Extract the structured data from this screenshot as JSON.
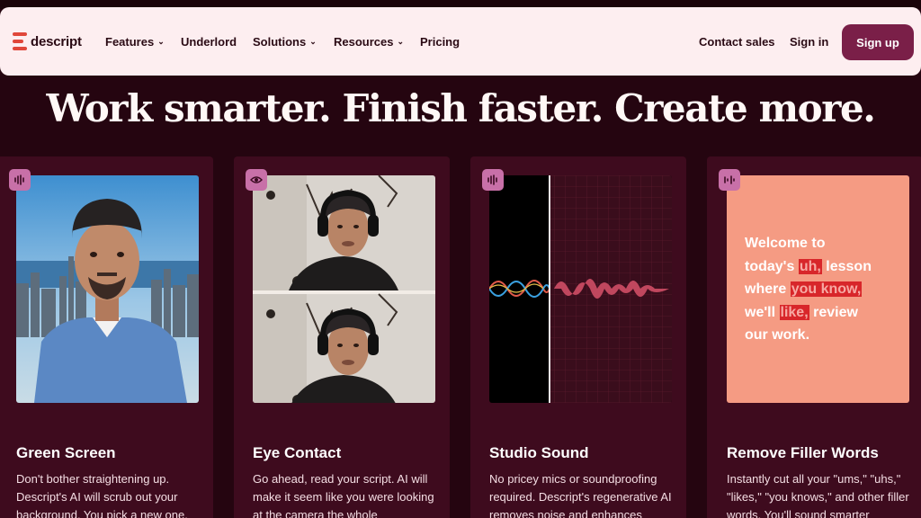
{
  "header": {
    "logo_text": "descript",
    "nav": [
      {
        "label": "Features",
        "dropdown": true
      },
      {
        "label": "Underlord",
        "dropdown": false
      },
      {
        "label": "Solutions",
        "dropdown": true
      },
      {
        "label": "Resources",
        "dropdown": true
      },
      {
        "label": "Pricing",
        "dropdown": false
      }
    ],
    "contact_sales": "Contact sales",
    "sign_in": "Sign in",
    "sign_up": "Sign up"
  },
  "hero": {
    "headline": "Work smarter. Finish faster. Create more."
  },
  "cards": [
    {
      "title": "Green Screen",
      "desc": "Don't bother straightening up. Descript's AI will scrub out your background. You pick a new one.",
      "badge_icon": "waveform-icon"
    },
    {
      "title": "Eye Contact",
      "desc": "Go ahead, read your script. AI will make it seem like you were looking at the camera the whole",
      "badge_icon": "eye-icon"
    },
    {
      "title": "Studio Sound",
      "desc": "No pricey mics or soundproofing required. Descript's regenerative AI removes noise and enhances",
      "badge_icon": "waveform-icon"
    },
    {
      "title": "Remove Filler Words",
      "desc": "Instantly cut all your \"ums,\" \"uhs,\" \"likes,\" \"you knows,\" and other filler words. You'll sound smarter",
      "badge_icon": "filler-words-icon"
    }
  ],
  "filler_demo": {
    "w1": "Welcome to",
    "w2": "today's",
    "f1": "uh,",
    "w3": "lesson",
    "w4": "where",
    "f2": "you know,",
    "w5": "we'll",
    "f3": "like,",
    "w6": "review",
    "w7": "our work."
  },
  "colors": {
    "background": "#250510",
    "nav_background": "#fdeef0",
    "card_background": "#3e0b1e",
    "accent": "#7a1f48",
    "badge": "#c870a8",
    "filler_card": "#f59b83",
    "filler_highlight": "#d8262a"
  }
}
